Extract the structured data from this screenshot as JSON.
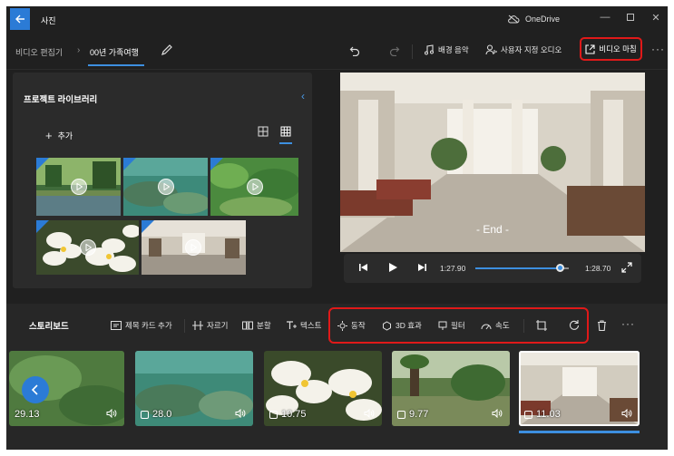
{
  "titlebar": {
    "app_title": "사진",
    "cloud_label": "OneDrive"
  },
  "toolbar": {
    "breadcrumb_root": "비디오 편집기",
    "breadcrumb_current": "00년 가족여행",
    "background_music": "배경 음악",
    "custom_audio": "사용자 지정 오디오",
    "finish_video": "비디오 마침"
  },
  "library": {
    "title": "프로젝트 라이브러리",
    "add_label": "추가"
  },
  "preview": {
    "end_label": "- End -",
    "current_time": "1:27.90",
    "total_time": "1:28.70",
    "progress": 0.9
  },
  "storyboard": {
    "title": "스토리보드",
    "add_title_card": "제목 카드 추가",
    "trim": "자르기",
    "split": "분할",
    "text": "텍스트",
    "motion": "동작",
    "effects_3d": "3D 효과",
    "filters": "필터",
    "speed": "속도",
    "clips": [
      {
        "duration": "29.13"
      },
      {
        "duration": "28.0"
      },
      {
        "duration": "10.75"
      },
      {
        "duration": "9.77"
      },
      {
        "duration": "11.03"
      }
    ]
  },
  "colors": {
    "accent": "#2b7bd6",
    "highlight": "#e01919",
    "background": "#202020",
    "panel": "#2b2b2b"
  }
}
